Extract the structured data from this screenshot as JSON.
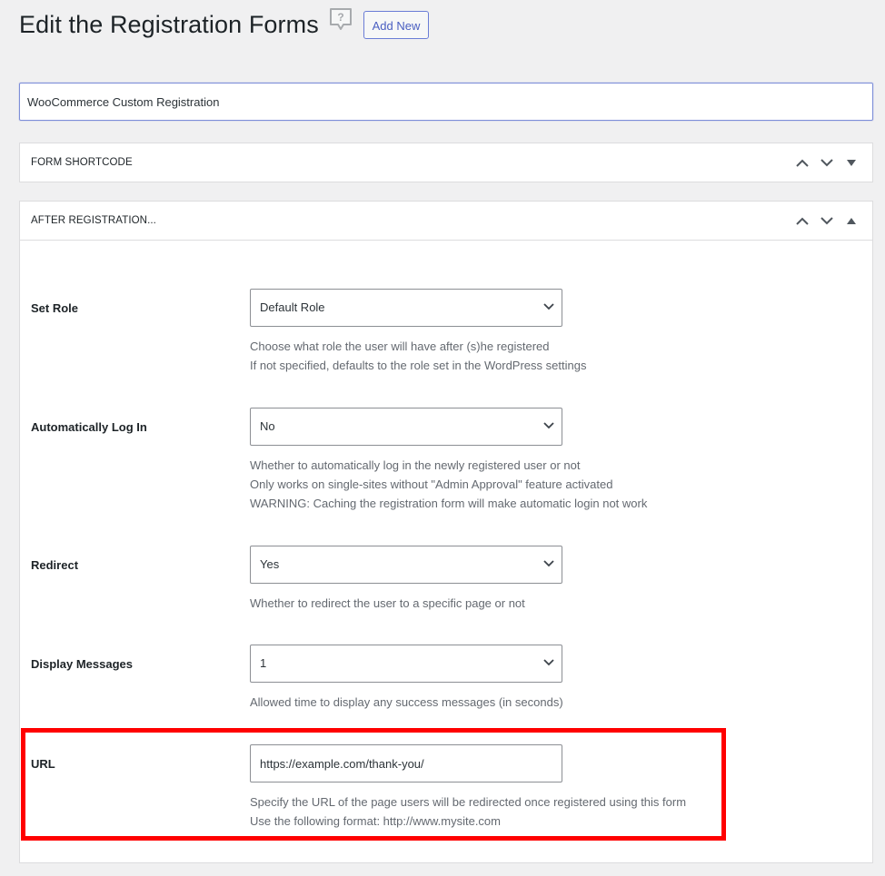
{
  "header": {
    "title": "Edit the Registration Forms",
    "help_icon": "help-speech-bubble-icon",
    "add_new_label": "Add New"
  },
  "form_title": {
    "value": "WooCommerce Custom Registration"
  },
  "panels": {
    "shortcode": {
      "title": "FORM SHORTCODE",
      "state": "collapsed"
    },
    "after_registration": {
      "title": "AFTER REGISTRATION...",
      "state": "expanded",
      "fields": {
        "set_role": {
          "label": "Set Role",
          "value": "Default Role",
          "description": [
            "Choose what role the user will have after (s)he registered",
            "If not specified, defaults to the role set in the WordPress settings"
          ]
        },
        "auto_login": {
          "label": "Automatically Log In",
          "value": "No",
          "description": [
            "Whether to automatically log in the newly registered user or not",
            "Only works on single-sites without \"Admin Approval\" feature activated",
            "WARNING: Caching the registration form will make automatic login not work"
          ]
        },
        "redirect": {
          "label": "Redirect",
          "value": "Yes",
          "description": [
            "Whether to redirect the user to a specific page or not"
          ]
        },
        "display_messages": {
          "label": "Display Messages",
          "value": "1",
          "description": [
            "Allowed time to display any success messages (in seconds)"
          ]
        },
        "url": {
          "label": "URL",
          "value": "https://example.com/thank-you/",
          "description": [
            "Specify the URL of the page users will be redirected once registered using this form",
            "Use the following format: http://www.mysite.com"
          ],
          "highlighted": true
        }
      }
    }
  },
  "colors": {
    "highlight": "#ff0000",
    "accent": "#4a5fc1",
    "background": "#f0f0f1"
  }
}
